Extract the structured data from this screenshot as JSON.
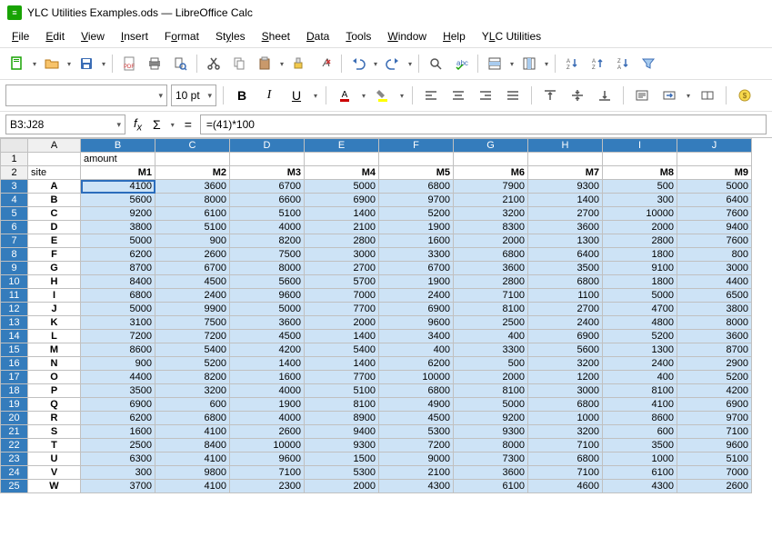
{
  "title": "YLC Utilities Examples.ods — LibreOffice Calc",
  "app_icon": "≡",
  "menu": [
    "File",
    "Edit",
    "View",
    "Insert",
    "Format",
    "Styles",
    "Sheet",
    "Data",
    "Tools",
    "Window",
    "Help",
    "YLC Utilities"
  ],
  "font_name": "",
  "font_size": "10 pt",
  "namebox": "B3:J28",
  "formula": "=(41)*100",
  "columns": [
    "A",
    "B",
    "C",
    "D",
    "E",
    "F",
    "G",
    "H",
    "I",
    "J"
  ],
  "selected_cols": [
    "B",
    "C",
    "D",
    "E",
    "F",
    "G",
    "H",
    "I",
    "J"
  ],
  "selected_rows": [
    3,
    4,
    5,
    6,
    7,
    8,
    9,
    10,
    11,
    12,
    13,
    14,
    15,
    16,
    17,
    18,
    19,
    20,
    21,
    22,
    23,
    24,
    25
  ],
  "rows": [
    {
      "n": 1,
      "cells": [
        "",
        "amount",
        "",
        "",
        "",
        "",
        "",
        "",
        "",
        ""
      ],
      "align": [
        "",
        "left",
        "",
        "",
        "",
        "",
        "",
        "",
        "",
        ""
      ]
    },
    {
      "n": 2,
      "cells": [
        "site",
        "M1",
        "M2",
        "M3",
        "M4",
        "M5",
        "M6",
        "M7",
        "M8",
        "M9"
      ],
      "align": [
        "left",
        "br",
        "br",
        "br",
        "br",
        "br",
        "br",
        "br",
        "br",
        "br"
      ]
    },
    {
      "n": 3,
      "cells": [
        "A",
        "4100",
        "3600",
        "6700",
        "5000",
        "6800",
        "7900",
        "9300",
        "500",
        "5000"
      ],
      "align": [
        "center",
        "",
        "",
        "",
        "",
        "",
        "",
        "",
        "",
        ""
      ],
      "active": "B"
    },
    {
      "n": 4,
      "cells": [
        "B",
        "5600",
        "8000",
        "6600",
        "6900",
        "9700",
        "2100",
        "1400",
        "300",
        "6400"
      ],
      "align": [
        "center",
        "",
        "",
        "",
        "",
        "",
        "",
        "",
        "",
        ""
      ]
    },
    {
      "n": 5,
      "cells": [
        "C",
        "9200",
        "6100",
        "5100",
        "1400",
        "5200",
        "3200",
        "2700",
        "10000",
        "7600"
      ],
      "align": [
        "center",
        "",
        "",
        "",
        "",
        "",
        "",
        "",
        "",
        ""
      ]
    },
    {
      "n": 6,
      "cells": [
        "D",
        "3800",
        "5100",
        "4000",
        "2100",
        "1900",
        "8300",
        "3600",
        "2000",
        "9400"
      ],
      "align": [
        "center",
        "",
        "",
        "",
        "",
        "",
        "",
        "",
        "",
        ""
      ]
    },
    {
      "n": 7,
      "cells": [
        "E",
        "5000",
        "900",
        "8200",
        "2800",
        "1600",
        "2000",
        "1300",
        "2800",
        "7600"
      ],
      "align": [
        "center",
        "",
        "",
        "",
        "",
        "",
        "",
        "",
        "",
        ""
      ]
    },
    {
      "n": 8,
      "cells": [
        "F",
        "6200",
        "2600",
        "7500",
        "3000",
        "3300",
        "6800",
        "6400",
        "1800",
        "800"
      ],
      "align": [
        "center",
        "",
        "",
        "",
        "",
        "",
        "",
        "",
        "",
        ""
      ]
    },
    {
      "n": 9,
      "cells": [
        "G",
        "8700",
        "6700",
        "8000",
        "2700",
        "6700",
        "3600",
        "3500",
        "9100",
        "3000"
      ],
      "align": [
        "center",
        "",
        "",
        "",
        "",
        "",
        "",
        "",
        "",
        ""
      ]
    },
    {
      "n": 10,
      "cells": [
        "H",
        "8400",
        "4500",
        "5600",
        "5700",
        "1900",
        "2800",
        "6800",
        "1800",
        "4400"
      ],
      "align": [
        "center",
        "",
        "",
        "",
        "",
        "",
        "",
        "",
        "",
        ""
      ]
    },
    {
      "n": 11,
      "cells": [
        "I",
        "6800",
        "2400",
        "9600",
        "7000",
        "2400",
        "7100",
        "1100",
        "5000",
        "6500"
      ],
      "align": [
        "center",
        "",
        "",
        "",
        "",
        "",
        "",
        "",
        "",
        ""
      ]
    },
    {
      "n": 12,
      "cells": [
        "J",
        "5000",
        "9900",
        "5000",
        "7700",
        "6900",
        "8100",
        "2700",
        "4700",
        "3800"
      ],
      "align": [
        "center",
        "",
        "",
        "",
        "",
        "",
        "",
        "",
        "",
        ""
      ]
    },
    {
      "n": 13,
      "cells": [
        "K",
        "3100",
        "7500",
        "3600",
        "2000",
        "9600",
        "2500",
        "2400",
        "4800",
        "8000"
      ],
      "align": [
        "center",
        "",
        "",
        "",
        "",
        "",
        "",
        "",
        "",
        ""
      ]
    },
    {
      "n": 14,
      "cells": [
        "L",
        "7200",
        "7200",
        "4500",
        "1400",
        "3400",
        "400",
        "6900",
        "5200",
        "3600"
      ],
      "align": [
        "center",
        "",
        "",
        "",
        "",
        "",
        "",
        "",
        "",
        ""
      ]
    },
    {
      "n": 15,
      "cells": [
        "M",
        "8600",
        "5400",
        "4200",
        "5400",
        "400",
        "3300",
        "5600",
        "1300",
        "8700"
      ],
      "align": [
        "center",
        "",
        "",
        "",
        "",
        "",
        "",
        "",
        "",
        ""
      ]
    },
    {
      "n": 16,
      "cells": [
        "N",
        "900",
        "5200",
        "1400",
        "1400",
        "6200",
        "500",
        "3200",
        "2400",
        "2900"
      ],
      "align": [
        "center",
        "",
        "",
        "",
        "",
        "",
        "",
        "",
        "",
        ""
      ]
    },
    {
      "n": 17,
      "cells": [
        "O",
        "4400",
        "8200",
        "1600",
        "7700",
        "10000",
        "2000",
        "1200",
        "400",
        "5200"
      ],
      "align": [
        "center",
        "",
        "",
        "",
        "",
        "",
        "",
        "",
        "",
        ""
      ]
    },
    {
      "n": 18,
      "cells": [
        "P",
        "3500",
        "3200",
        "4000",
        "5100",
        "6800",
        "8100",
        "3000",
        "8100",
        "4200"
      ],
      "align": [
        "center",
        "",
        "",
        "",
        "",
        "",
        "",
        "",
        "",
        ""
      ]
    },
    {
      "n": 19,
      "cells": [
        "Q",
        "6900",
        "600",
        "1900",
        "8100",
        "4900",
        "5000",
        "6800",
        "4100",
        "6900"
      ],
      "align": [
        "center",
        "",
        "",
        "",
        "",
        "",
        "",
        "",
        "",
        ""
      ]
    },
    {
      "n": 20,
      "cells": [
        "R",
        "6200",
        "6800",
        "4000",
        "8900",
        "4500",
        "9200",
        "1000",
        "8600",
        "9700"
      ],
      "align": [
        "center",
        "",
        "",
        "",
        "",
        "",
        "",
        "",
        "",
        ""
      ]
    },
    {
      "n": 21,
      "cells": [
        "S",
        "1600",
        "4100",
        "2600",
        "9400",
        "5300",
        "9300",
        "3200",
        "600",
        "7100"
      ],
      "align": [
        "center",
        "",
        "",
        "",
        "",
        "",
        "",
        "",
        "",
        ""
      ]
    },
    {
      "n": 22,
      "cells": [
        "T",
        "2500",
        "8400",
        "10000",
        "9300",
        "7200",
        "8000",
        "7100",
        "3500",
        "9600"
      ],
      "align": [
        "center",
        "",
        "",
        "",
        "",
        "",
        "",
        "",
        "",
        ""
      ]
    },
    {
      "n": 23,
      "cells": [
        "U",
        "6300",
        "4100",
        "9600",
        "1500",
        "9000",
        "7300",
        "6800",
        "1000",
        "5100"
      ],
      "align": [
        "center",
        "",
        "",
        "",
        "",
        "",
        "",
        "",
        "",
        ""
      ]
    },
    {
      "n": 24,
      "cells": [
        "V",
        "300",
        "9800",
        "7100",
        "5300",
        "2100",
        "3600",
        "7100",
        "6100",
        "7000"
      ],
      "align": [
        "center",
        "",
        "",
        "",
        "",
        "",
        "",
        "",
        "",
        ""
      ]
    },
    {
      "n": 25,
      "cells": [
        "W",
        "3700",
        "4100",
        "2300",
        "2000",
        "4300",
        "6100",
        "4600",
        "4300",
        "2600"
      ],
      "align": [
        "center",
        "",
        "",
        "",
        "",
        "",
        "",
        "",
        "",
        ""
      ]
    }
  ],
  "chart_data": {
    "type": "table",
    "columns": [
      "site",
      "M1",
      "M2",
      "M3",
      "M4",
      "M5",
      "M6",
      "M7",
      "M8",
      "M9"
    ],
    "rows": [
      [
        "A",
        4100,
        3600,
        6700,
        5000,
        6800,
        7900,
        9300,
        500,
        5000
      ],
      [
        "B",
        5600,
        8000,
        6600,
        6900,
        9700,
        2100,
        1400,
        300,
        6400
      ],
      [
        "C",
        9200,
        6100,
        5100,
        1400,
        5200,
        3200,
        2700,
        10000,
        7600
      ],
      [
        "D",
        3800,
        5100,
        4000,
        2100,
        1900,
        8300,
        3600,
        2000,
        9400
      ],
      [
        "E",
        5000,
        900,
        8200,
        2800,
        1600,
        2000,
        1300,
        2800,
        7600
      ],
      [
        "F",
        6200,
        2600,
        7500,
        3000,
        3300,
        6800,
        6400,
        1800,
        800
      ],
      [
        "G",
        8700,
        6700,
        8000,
        2700,
        6700,
        3600,
        3500,
        9100,
        3000
      ],
      [
        "H",
        8400,
        4500,
        5600,
        5700,
        1900,
        2800,
        6800,
        1800,
        4400
      ],
      [
        "I",
        6800,
        2400,
        9600,
        7000,
        2400,
        7100,
        1100,
        5000,
        6500
      ],
      [
        "J",
        5000,
        9900,
        5000,
        7700,
        6900,
        8100,
        2700,
        4700,
        3800
      ],
      [
        "K",
        3100,
        7500,
        3600,
        2000,
        9600,
        2500,
        2400,
        4800,
        8000
      ],
      [
        "L",
        7200,
        7200,
        4500,
        1400,
        3400,
        400,
        6900,
        5200,
        3600
      ],
      [
        "M",
        8600,
        5400,
        4200,
        5400,
        400,
        3300,
        5600,
        1300,
        8700
      ],
      [
        "N",
        900,
        5200,
        1400,
        1400,
        6200,
        500,
        3200,
        2400,
        2900
      ],
      [
        "O",
        4400,
        8200,
        1600,
        7700,
        10000,
        2000,
        1200,
        400,
        5200
      ],
      [
        "P",
        3500,
        3200,
        4000,
        5100,
        6800,
        8100,
        3000,
        8100,
        4200
      ],
      [
        "Q",
        6900,
        600,
        1900,
        8100,
        4900,
        5000,
        6800,
        4100,
        6900
      ],
      [
        "R",
        6200,
        6800,
        4000,
        8900,
        4500,
        9200,
        1000,
        8600,
        9700
      ],
      [
        "S",
        1600,
        4100,
        2600,
        9400,
        5300,
        9300,
        3200,
        600,
        7100
      ],
      [
        "T",
        2500,
        8400,
        10000,
        9300,
        7200,
        8000,
        7100,
        3500,
        9600
      ],
      [
        "U",
        6300,
        4100,
        9600,
        1500,
        9000,
        7300,
        6800,
        1000,
        5100
      ],
      [
        "V",
        300,
        9800,
        7100,
        5300,
        2100,
        3600,
        7100,
        6100,
        7000
      ],
      [
        "W",
        3700,
        4100,
        2300,
        2000,
        4300,
        6100,
        4600,
        4300,
        2600
      ]
    ]
  }
}
